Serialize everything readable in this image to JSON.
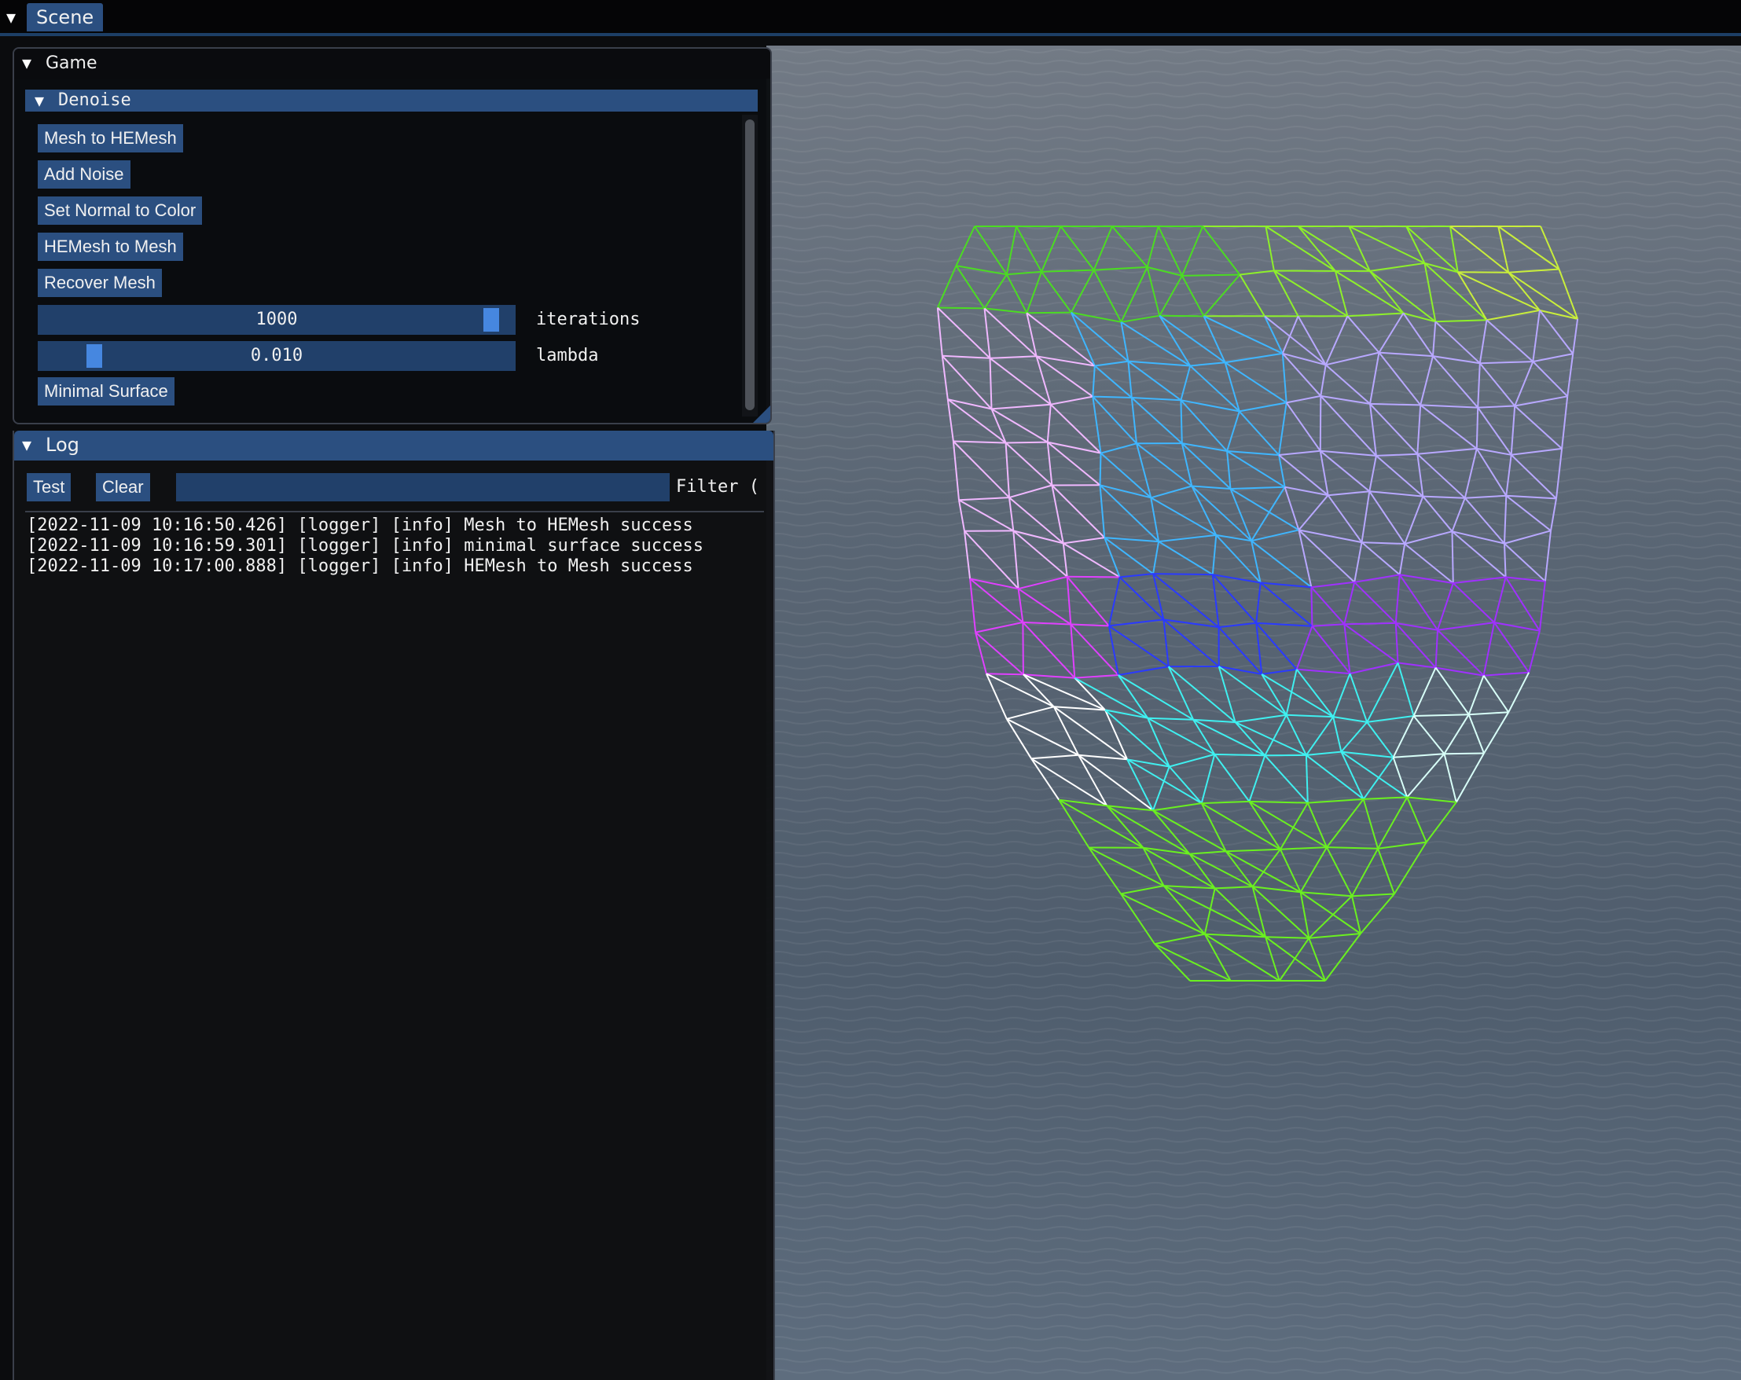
{
  "menubar": {
    "tab_label": "Scene"
  },
  "game_window": {
    "title": "Game",
    "section": "Denoise",
    "buttons": {
      "mesh_to_hemesh": "Mesh to HEMesh",
      "add_noise": "Add Noise",
      "set_normal_to_color": "Set Normal to Color",
      "hemesh_to_mesh": "HEMesh to Mesh",
      "recover_mesh": "Recover Mesh",
      "minimal_surface": "Minimal Surface"
    },
    "sliders": {
      "iterations": {
        "value": "1000",
        "label": "iterations",
        "fraction": 0.97
      },
      "lambda": {
        "value": "0.010",
        "label": "lambda",
        "fraction": 0.1
      }
    }
  },
  "log_window": {
    "title": "Log",
    "buttons": {
      "test": "Test",
      "clear": "Clear"
    },
    "filter_value": "",
    "filter_label": "Filter (",
    "lines": [
      "[2022-11-09 10:16:50.426] [logger] [info] Mesh to HEMesh success",
      "[2022-11-09 10:16:59.301] [logger] [info] minimal surface success",
      "[2022-11-09 10:17:00.888] [logger] [info] HEMesh to Mesh success"
    ]
  },
  "icons": {
    "menu_toggle": "triangle-down-icon",
    "collapse": "triangle-down-icon"
  },
  "colors": {
    "accent": "#2b4f80",
    "slider_grab": "#4687e0",
    "background": "#0b0c0e",
    "water": "#59677a"
  }
}
